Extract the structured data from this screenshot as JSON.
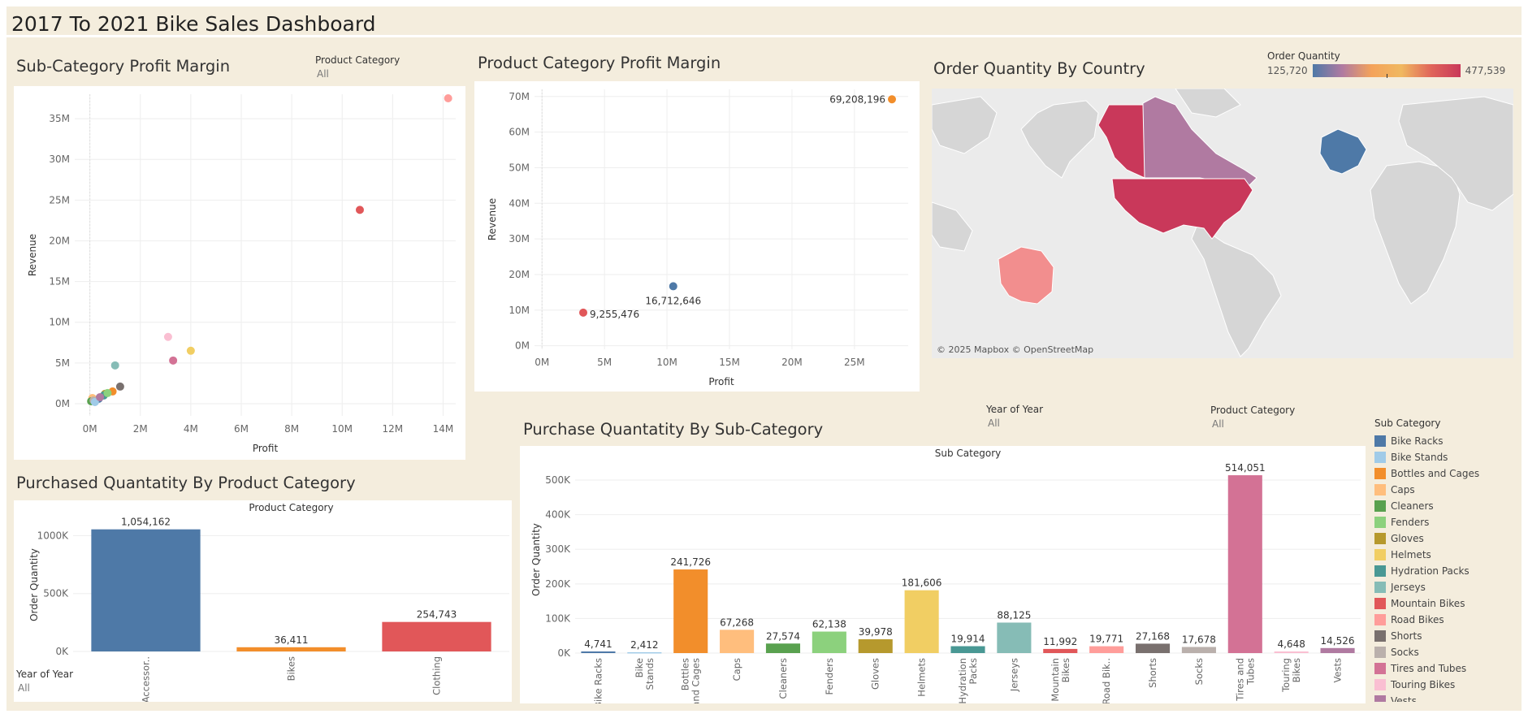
{
  "dashboard": {
    "title": "2017 To 2021 Bike Sales Dashboard"
  },
  "filters": {
    "product_category_1": {
      "label": "Product Category",
      "value": "All"
    },
    "year_1": {
      "label": "Year of Year",
      "value": "All"
    },
    "product_category_2": {
      "label": "Product Category",
      "value": "All"
    },
    "year_2": {
      "label": "Year of Year",
      "value": "All"
    }
  },
  "panels": {
    "subcat_profit": {
      "title": "Sub-Category Profit Margin",
      "xlabel": "Profit",
      "ylabel": "Revenue"
    },
    "prodcat_profit": {
      "title": "Product Category Profit Margin",
      "xlabel": "Profit",
      "ylabel": "Revenue"
    },
    "order_country": {
      "title": "Order Quantity By Country",
      "legend_title": "Order Quantity",
      "min_label": "125,720",
      "max_label": "477,539",
      "attribution": "© 2025 Mapbox © OpenStreetMap"
    },
    "purch_prodcat": {
      "title": "Purchased Quantatity By Product Category",
      "header": "Product Category",
      "ylabel": "Order Quantity"
    },
    "purch_subcat": {
      "title": "Purchase Quantatity By Sub-Category",
      "header": "Sub Category",
      "ylabel": "Order Quantity"
    }
  },
  "legend": {
    "title": "Sub Category",
    "items": [
      {
        "label": "Bike Racks",
        "color": "#4e79a7"
      },
      {
        "label": "Bike Stands",
        "color": "#a0cbe8"
      },
      {
        "label": "Bottles and Cages",
        "color": "#f28e2b"
      },
      {
        "label": "Caps",
        "color": "#ffbe7d"
      },
      {
        "label": "Cleaners",
        "color": "#59a14f"
      },
      {
        "label": "Fenders",
        "color": "#8cd17d"
      },
      {
        "label": "Gloves",
        "color": "#b6992d"
      },
      {
        "label": "Helmets",
        "color": "#f1ce63"
      },
      {
        "label": "Hydration Packs",
        "color": "#499894"
      },
      {
        "label": "Jerseys",
        "color": "#86bcb6"
      },
      {
        "label": "Mountain Bikes",
        "color": "#e15759"
      },
      {
        "label": "Road Bikes",
        "color": "#ff9d9a"
      },
      {
        "label": "Shorts",
        "color": "#79706e"
      },
      {
        "label": "Socks",
        "color": "#bab0ac"
      },
      {
        "label": "Tires and Tubes",
        "color": "#d37295"
      },
      {
        "label": "Touring Bikes",
        "color": "#fabfd2"
      },
      {
        "label": "Vests",
        "color": "#b07aa1"
      }
    ]
  },
  "chart_data": [
    {
      "id": "subcat_scatter",
      "type": "scatter",
      "title": "Sub-Category Profit Margin",
      "xlabel": "Profit",
      "ylabel": "Revenue",
      "xlim": [
        -0.6,
        14.5
      ],
      "ylim": [
        -1.5,
        38
      ],
      "x_ticks": [
        0,
        2,
        4,
        6,
        8,
        10,
        12,
        14
      ],
      "x_tick_labels": [
        "0M",
        "2M",
        "4M",
        "6M",
        "8M",
        "10M",
        "12M",
        "14M"
      ],
      "y_ticks": [
        0,
        5,
        10,
        15,
        20,
        25,
        30,
        35
      ],
      "y_tick_labels": [
        "0M",
        "5M",
        "10M",
        "15M",
        "20M",
        "25M",
        "30M",
        "35M"
      ],
      "points": [
        {
          "name": "Road Bikes",
          "x": 14.2,
          "y": 37.5,
          "color": "#ff9d9a"
        },
        {
          "name": "Mountain Bikes",
          "x": 10.7,
          "y": 23.8,
          "color": "#e15759"
        },
        {
          "name": "Touring Bikes",
          "x": 3.1,
          "y": 8.2,
          "color": "#fabfd2"
        },
        {
          "name": "Helmets",
          "x": 4.0,
          "y": 6.5,
          "color": "#f1ce63"
        },
        {
          "name": "Tires and Tubes",
          "x": 3.3,
          "y": 5.3,
          "color": "#d37295"
        },
        {
          "name": "Jerseys",
          "x": 1.0,
          "y": 4.7,
          "color": "#86bcb6"
        },
        {
          "name": "Shorts",
          "x": 1.2,
          "y": 2.1,
          "color": "#79706e"
        },
        {
          "name": "Bottles and Cages",
          "x": 0.9,
          "y": 1.5,
          "color": "#f28e2b"
        },
        {
          "name": "Gloves",
          "x": 0.6,
          "y": 1.2,
          "color": "#b6992d"
        },
        {
          "name": "Hydration Packs",
          "x": 0.55,
          "y": 1.0,
          "color": "#499894"
        },
        {
          "name": "Fenders",
          "x": 0.7,
          "y": 1.3,
          "color": "#8cd17d"
        },
        {
          "name": "Bike Racks",
          "x": 0.35,
          "y": 0.6,
          "color": "#4e79a7"
        },
        {
          "name": "Caps",
          "x": 0.1,
          "y": 0.7,
          "color": "#ffbe7d"
        },
        {
          "name": "Cleaners",
          "x": 0.05,
          "y": 0.3,
          "color": "#59a14f"
        },
        {
          "name": "Socks",
          "x": 0.15,
          "y": 0.4,
          "color": "#bab0ac"
        },
        {
          "name": "Bike Stands",
          "x": 0.2,
          "y": 0.2,
          "color": "#a0cbe8"
        },
        {
          "name": "Vests",
          "x": 0.4,
          "y": 0.8,
          "color": "#b07aa1"
        }
      ]
    },
    {
      "id": "prodcat_scatter",
      "type": "scatter",
      "title": "Product Category Profit Margin",
      "xlabel": "Profit",
      "ylabel": "Revenue",
      "xlim": [
        -0.6,
        29.3
      ],
      "ylim": [
        -1,
        72
      ],
      "x_ticks": [
        0,
        5,
        10,
        15,
        20,
        25
      ],
      "x_tick_labels": [
        "0M",
        "5M",
        "10M",
        "15M",
        "20M",
        "25M"
      ],
      "y_ticks": [
        0,
        10,
        20,
        30,
        40,
        50,
        60,
        70
      ],
      "y_tick_labels": [
        "0M",
        "10M",
        "20M",
        "30M",
        "40M",
        "50M",
        "60M",
        "70M"
      ],
      "points": [
        {
          "x": 28.0,
          "y": 69.2,
          "label": "69,208,196",
          "color": "#f28e2b",
          "label_side": "left"
        },
        {
          "x": 10.5,
          "y": 16.7,
          "label": "16,712,646",
          "color": "#4e79a7",
          "label_side": "below"
        },
        {
          "x": 3.3,
          "y": 9.3,
          "label": "9,255,476",
          "color": "#e15759",
          "label_side": "right"
        }
      ]
    },
    {
      "id": "prodcat_bar",
      "type": "bar",
      "title": "Purchased Quantatity By Product Category",
      "ylabel": "Order Quantity",
      "ylim": [
        0,
        1150000
      ],
      "y_ticks": [
        0,
        500000,
        1000000
      ],
      "y_tick_labels": [
        "0K",
        "500K",
        "1000K"
      ],
      "categories": [
        "Accessor..",
        "Bikes",
        "Clothing"
      ],
      "values": [
        1054162,
        36411,
        254743
      ],
      "value_labels": [
        "1,054,162",
        "36,411",
        "254,743"
      ],
      "colors": [
        "#4e79a7",
        "#f28e2b",
        "#e15759"
      ]
    },
    {
      "id": "subcat_bar",
      "type": "bar",
      "title": "Purchase Quantatity By Sub-Category",
      "ylabel": "Order Quantity",
      "ylim": [
        0,
        540000
      ],
      "y_ticks": [
        0,
        100000,
        200000,
        300000,
        400000,
        500000
      ],
      "y_tick_labels": [
        "0K",
        "100K",
        "200K",
        "300K",
        "400K",
        "500K"
      ],
      "categories": [
        "Bike Racks",
        "Bike Stands",
        "Bottles and Cages",
        "Caps",
        "Cleaners",
        "Fenders",
        "Gloves",
        "Helmets",
        "Hydration Packs",
        "Jerseys",
        "Mountain Bikes",
        "Road Bik..",
        "Shorts",
        "Socks",
        "Tires and Tubes",
        "Touring Bikes",
        "Vests"
      ],
      "category_lines": [
        [
          "Bike Racks"
        ],
        [
          "Bike",
          "Stands"
        ],
        [
          "Bottles",
          "and Cages"
        ],
        [
          "Caps"
        ],
        [
          "Cleaners"
        ],
        [
          "Fenders"
        ],
        [
          "Gloves"
        ],
        [
          "Helmets"
        ],
        [
          "Hydration",
          "Packs"
        ],
        [
          "Jerseys"
        ],
        [
          "Mountain",
          "Bikes"
        ],
        [
          "Road Bik.."
        ],
        [
          "Shorts"
        ],
        [
          "Socks"
        ],
        [
          "Tires and",
          "Tubes"
        ],
        [
          "Touring",
          "Bikes"
        ],
        [
          "Vests"
        ]
      ],
      "values": [
        4741,
        2412,
        241726,
        67268,
        27574,
        62138,
        39978,
        181606,
        19914,
        88125,
        11992,
        19771,
        27168,
        17678,
        514051,
        4648,
        14526
      ],
      "value_labels": [
        "4,741",
        "2,412",
        "241,726",
        "67,268",
        "27,574",
        "62,138",
        "39,978",
        "181,606",
        "19,914",
        "88,125",
        "11,992",
        "19,771",
        "27,168",
        "17,678",
        "514,051",
        "4,648",
        "14,526"
      ],
      "colors": [
        "#4e79a7",
        "#a0cbe8",
        "#f28e2b",
        "#ffbe7d",
        "#59a14f",
        "#8cd17d",
        "#b6992d",
        "#f1ce63",
        "#499894",
        "#86bcb6",
        "#e15759",
        "#ff9d9a",
        "#79706e",
        "#bab0ac",
        "#d37295",
        "#fabfd2",
        "#b07aa1"
      ]
    }
  ],
  "map": {
    "countries": [
      {
        "name": "United States",
        "color": "#c9385a"
      },
      {
        "name": "Canada",
        "color": "#b07aa1"
      },
      {
        "name": "Australia",
        "color": "#f28e8e"
      },
      {
        "name": "Europe",
        "color": "#4e79a7"
      }
    ],
    "scale_colors": [
      "#4e79a7",
      "#b07aa1",
      "#f4a35a",
      "#f0b860",
      "#e0655a",
      "#c9385a"
    ]
  }
}
